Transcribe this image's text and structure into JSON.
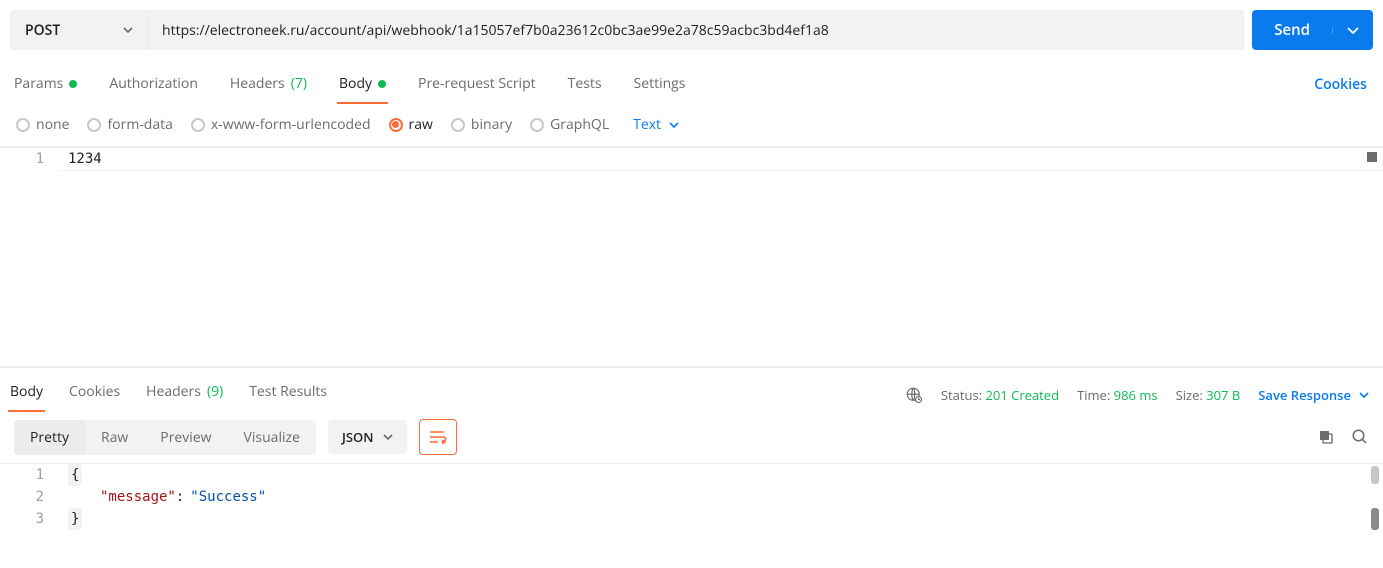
{
  "request": {
    "method": "POST",
    "url": "https://electroneek.ru/account/api/webhook/1a15057ef7b0a23612c0bc3ae99e2a78c59acbc3bd4ef1a8",
    "send_label": "Send"
  },
  "tabs": {
    "params": "Params",
    "authorization": "Authorization",
    "headers": "Headers",
    "headers_count": "(7)",
    "body": "Body",
    "prerequest": "Pre-request Script",
    "tests": "Tests",
    "settings": "Settings",
    "cookies": "Cookies"
  },
  "body_options": {
    "none": "none",
    "form_data": "form-data",
    "x_www": "x-www-form-urlencoded",
    "raw": "raw",
    "binary": "binary",
    "graphql": "GraphQL",
    "subtype": "Text"
  },
  "request_body": {
    "gutter": "1",
    "content": "1234"
  },
  "response_tabs": {
    "body": "Body",
    "cookies": "Cookies",
    "headers": "Headers",
    "headers_count": "(9)",
    "test_results": "Test Results"
  },
  "response_meta": {
    "status_label": "Status:",
    "status_value": "201 Created",
    "time_label": "Time:",
    "time_value": "986 ms",
    "size_label": "Size:",
    "size_value": "307 B",
    "save_label": "Save Response"
  },
  "response_view": {
    "pretty": "Pretty",
    "raw": "Raw",
    "preview": "Preview",
    "visualize": "Visualize",
    "format": "JSON"
  },
  "response_body": {
    "g1": "1",
    "g2": "2",
    "g3": "3",
    "brace_open": "{",
    "brace_close": "}",
    "key": "\"message\"",
    "colon": ":",
    "value": "\"Success\""
  }
}
